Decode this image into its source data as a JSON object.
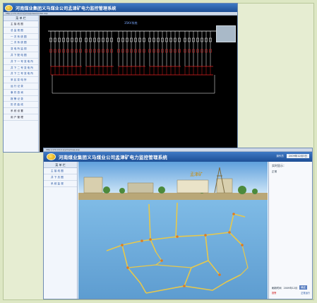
{
  "window1": {
    "title": "河南煤业集团义马煤业公司孟津矿电力监控管理系统",
    "address": "http://172.16.0.1/yima/power/index.asp",
    "sidebar_header": "菜 单 栏",
    "sidebar_items": [
      "主 接 线 图",
      "总 监 视 图",
      "一 次 系 统 图",
      "二 次 系 统 图",
      "变 电 所 监 视",
      "井 下 配 电 图",
      "井 下 一 号 变 电 所",
      "井 下 二 号 变 电 所",
      "井 下 三 号 变 电 所",
      "采 区 变 电 所",
      "运 行 记 录",
      "事 件 查 询",
      "报 警 记 录",
      "历 史 曲 线",
      "系 统 设 置",
      "用 户 管 理"
    ],
    "diagram_title": "35KV系统"
  },
  "window2": {
    "browser_address": "http://172.16.0.1/yima/map.asp",
    "title": "河南煤业集团义马煤业公司孟津矿电力监控管理系统",
    "user_label": "操作员",
    "user_value": "2009年12月3日",
    "sidebar_header": "菜 单 栏",
    "sidebar_items": [
      "主 接 线 图",
      "井 下 总 图",
      "系 统 监 视"
    ],
    "right_panel": {
      "header": "实时显示：",
      "sub": "正常",
      "row_label": "刷新时间",
      "row_value": "2009年12月",
      "btn": "确定",
      "legend_alarm": "报警",
      "legend_normal": "正常运行"
    },
    "scene_sign": "孟津矿"
  },
  "colors": {
    "titlebar": "#2b62ad",
    "diagram_bg": "#000000",
    "line_normal": "#ffffff",
    "line_alarm": "#e02020",
    "sky": "#7fb8e6",
    "ground": "#6ea7d6",
    "tunnel": "#e8c84a"
  }
}
